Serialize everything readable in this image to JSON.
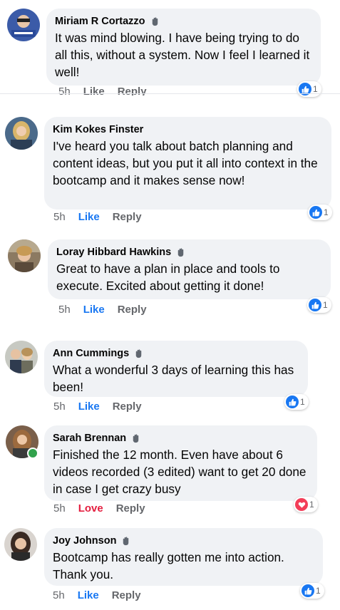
{
  "comments": [
    {
      "author": "Miriam R Cortazzo",
      "text": "It was mind blowing. I have being trying to do all this, without a system. Now I feel I learned it well!",
      "time": "5h",
      "like_label": "Like",
      "reply_label": "Reply",
      "reaction_type": "like",
      "reaction_count": "1"
    },
    {
      "author": "Kim Kokes Finster",
      "text": "I've heard you talk about batch planning and content ideas, but you put it all into context in the bootcamp and it makes sense now!",
      "time": "5h",
      "like_label": "Like",
      "reply_label": "Reply",
      "reaction_type": "like",
      "reaction_count": "1"
    },
    {
      "author": "Loray Hibbard Hawkins",
      "text": "Great to have a plan in place and tools to execute. Excited about getting it done!",
      "time": "5h",
      "like_label": "Like",
      "reply_label": "Reply",
      "reaction_type": "like",
      "reaction_count": "1"
    },
    {
      "author": "Ann Cummings",
      "text": "What a wonderful 3 days of learning this has been!",
      "time": "5h",
      "like_label": "Like",
      "reply_label": "Reply",
      "reaction_type": "like",
      "reaction_count": "1"
    },
    {
      "author": "Sarah Brennan",
      "text": "Finished the 12 month. Even have about 6 videos recorded (3 edited) want to get 20 done in case I get crazy busy",
      "time": "5h",
      "like_label": "Love",
      "reply_label": "Reply",
      "reaction_type": "love",
      "reaction_count": "1"
    },
    {
      "author": "Joy Johnson",
      "text": "Bootcamp has really gotten me into action. Thank you.",
      "time": "5h",
      "like_label": "Like",
      "reply_label": "Reply",
      "reaction_type": "like",
      "reaction_count": "1"
    }
  ],
  "colors": {
    "like_blue": "#1877f2",
    "love_red": "#e41e3f",
    "bubble_bg": "#f0f2f5",
    "meta_gray": "#65676b"
  }
}
